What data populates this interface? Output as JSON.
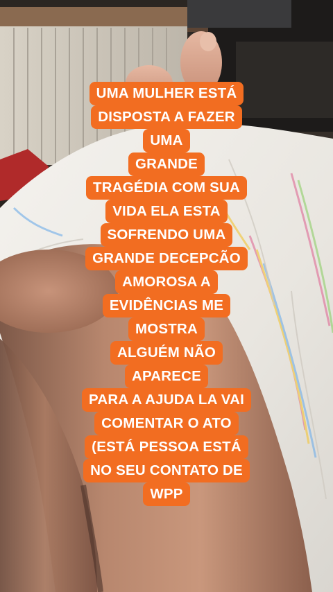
{
  "caption": {
    "lines": [
      "UMA MULHER ESTÁ",
      "DISPOSTA A FAZER",
      "UMA",
      "GRANDE",
      "TRAGÉDIA COM SUA",
      "VIDA ELA ESTA",
      "SOFRENDO UMA",
      "GRANDE DECEPCÃO",
      "AMOROSA A",
      "EVIDÊNCIAS ME",
      "MOSTRA",
      "ALGUÉM NÃO",
      "APARECE",
      "PARA A AJUDA LA VAI",
      "COMENTAR O ATO",
      "(ESTÁ PESSOA ESTÁ",
      "NO SEU CONTATO DE",
      "WPP"
    ],
    "background_color": "#f26d21",
    "text_color": "#ffffff"
  }
}
